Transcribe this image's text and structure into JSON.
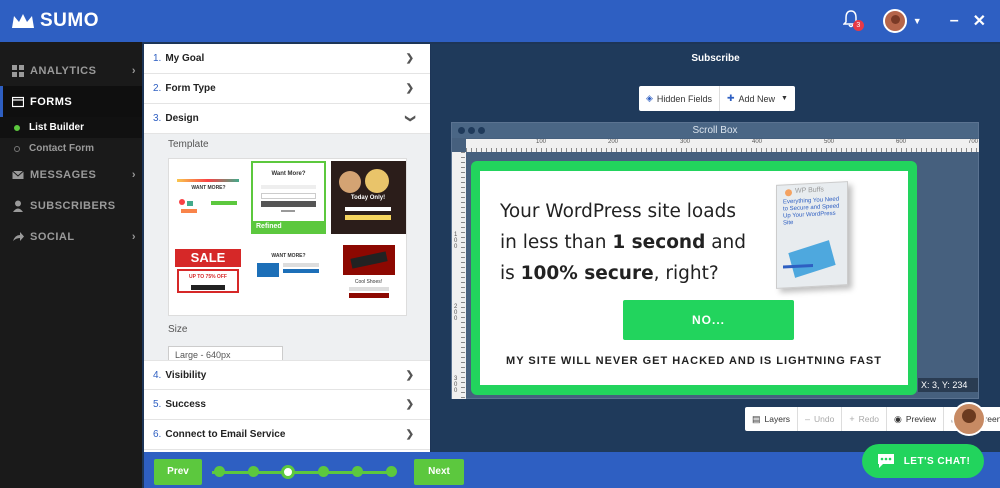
{
  "header": {
    "brand": "SUMO",
    "notification_count": "3",
    "minimize": "–",
    "close": "✕"
  },
  "sidebar": {
    "items": [
      {
        "label": "ANALYTICS"
      },
      {
        "label": "FORMS"
      },
      {
        "label": "MESSAGES"
      },
      {
        "label": "SUBSCRIBERS"
      },
      {
        "label": "SOCIAL"
      }
    ],
    "forms_sub": [
      {
        "label": "List Builder"
      },
      {
        "label": "Contact Form"
      }
    ]
  },
  "steps": [
    {
      "num": "1.",
      "label": "My Goal"
    },
    {
      "num": "2.",
      "label": "Form Type"
    },
    {
      "num": "3.",
      "label": "Design"
    },
    {
      "num": "4.",
      "label": "Visibility"
    },
    {
      "num": "5.",
      "label": "Success"
    },
    {
      "num": "6.",
      "label": "Connect to Email Service"
    }
  ],
  "design": {
    "template_label": "Template",
    "size_label": "Size",
    "size_value": "Large - 640px",
    "selected_template": "Refined",
    "templates": [
      {
        "title": "WANT MORE?"
      },
      {
        "title": "Want More?"
      },
      {
        "title": "Today Only!"
      },
      {
        "title": "SALE",
        "subtitle": "UP TO 75% OFF"
      },
      {
        "title": "WANT MORE?"
      },
      {
        "title": "Cool Shoes!"
      }
    ]
  },
  "wizard": {
    "prev": "Prev",
    "next": "Next"
  },
  "canvas": {
    "title": "Subscribe",
    "toolbar": {
      "hidden_fields": "Hidden Fields",
      "add_new": "Add New"
    },
    "scrollbox_title": "Scroll Box",
    "ruler_top": [
      "100",
      "200",
      "300",
      "400",
      "500",
      "600",
      "700"
    ],
    "ruler_left": [
      "100",
      "200",
      "300"
    ],
    "coords": "X: 3, Y: 234",
    "bottom_toolbar": {
      "layers": "Layers",
      "undo": "Undo",
      "redo": "Redo",
      "preview": "Preview",
      "fullscreen": "Fullscreen"
    }
  },
  "optin": {
    "line1": "Your WordPress site loads",
    "line2_pre": "in less than ",
    "line2_bold": "1 second",
    "line2_post": " and",
    "line3_pre": "is ",
    "line3_bold": "100% secure",
    "line3_post": ", right?",
    "button": "NO...",
    "footer": "MY SITE WILL NEVER GET HACKED AND IS LIGHTNING FAST",
    "ebook_brand": "WP Buffs",
    "ebook_text": "Everything You Need to Secure and Speed Up Your WordPress Site"
  },
  "chat": {
    "label": "LET'S CHAT!"
  },
  "colors": {
    "brand_blue": "#2e5fc2",
    "accent_green": "#22d45d",
    "wizard_green": "#5cc83e"
  }
}
